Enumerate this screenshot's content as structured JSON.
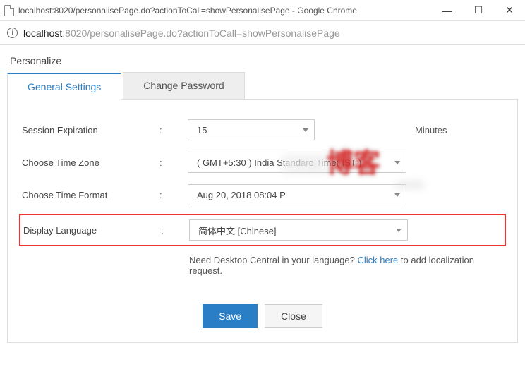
{
  "window": {
    "title": "localhost:8020/personalisePage.do?actionToCall=showPersonalisePage - Google Chrome"
  },
  "address": {
    "host": "localhost",
    "path": ":8020/personalisePage.do?actionToCall=showPersonalisePage"
  },
  "page": {
    "title": "Personalize",
    "tabs": {
      "general": "General Settings",
      "password": "Change Password"
    }
  },
  "form": {
    "sessionExpiration": {
      "label": "Session Expiration",
      "value": "15",
      "suffix": "Minutes"
    },
    "timeZone": {
      "label": "Choose Time Zone",
      "value": "( GMT+5:30 ) India Standard Time( IST )"
    },
    "timeFormat": {
      "label": "Choose Time Format",
      "value": "Aug 20, 2018 08:04 P"
    },
    "language": {
      "label": "Display Language",
      "value": "简体中文 [Chinese]"
    },
    "help": {
      "pre": "Need Desktop Central in your language? ",
      "link": "Click here",
      "post": " to add localization request."
    }
  },
  "buttons": {
    "save": "Save",
    "close": "Close"
  },
  "colon": ":"
}
